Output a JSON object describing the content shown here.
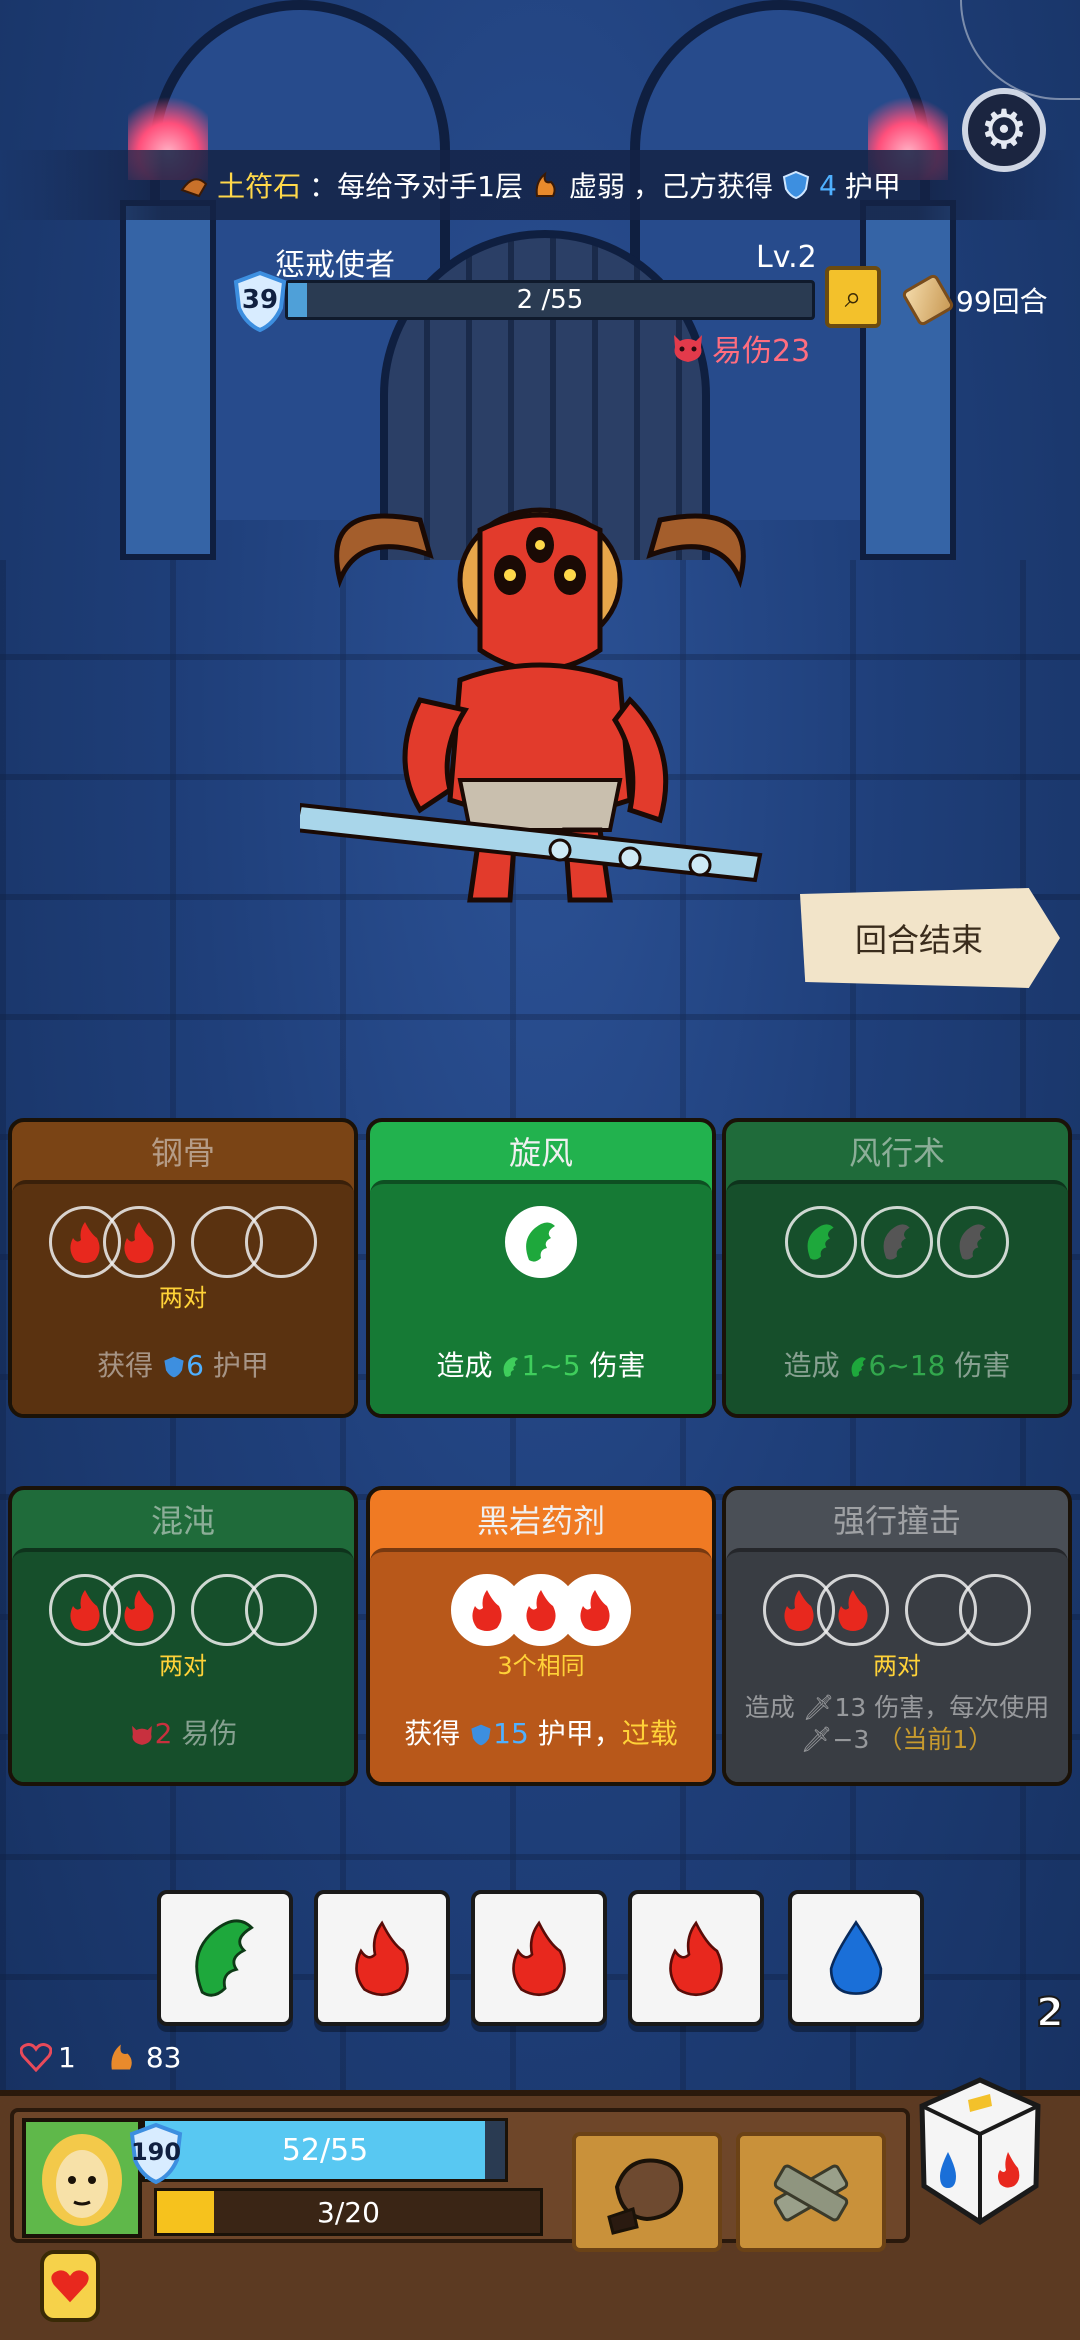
{
  "rune_banner": {
    "name": "土符石",
    "text_part1": "：每给予对手1层",
    "status_word": "虚弱",
    "text_part2": "，己方获得",
    "armor_value": "4",
    "armor_word": "护甲"
  },
  "enemy": {
    "name": "惩戒使者",
    "level": "Lv.2",
    "shield": "39",
    "hp_text": "2 /55",
    "hp_fraction": 0.036,
    "vulnerable": "易伤23"
  },
  "turns": "99回合",
  "end_turn_label": "回合结束",
  "cards": [
    {
      "title": "钢骨",
      "condition": "两对",
      "effect_prefix": "获得",
      "effect_value": "6",
      "effect_suffix": "护甲"
    },
    {
      "title": "旋风",
      "effect_prefix": "造成",
      "effect_value": "1~5",
      "effect_suffix": "伤害"
    },
    {
      "title": "风行术",
      "effect_prefix": "造成",
      "effect_value": "6~18",
      "effect_suffix": "伤害"
    },
    {
      "title": "混沌",
      "condition": "两对",
      "effect_value": "2",
      "effect_suffix": "易伤"
    },
    {
      "title": "黑岩药剂",
      "condition": "3个相同",
      "effect_prefix": "获得",
      "effect_value": "15",
      "effect_suffix": "护甲，",
      "effect_extra": "过载"
    },
    {
      "title": "强行撞击",
      "condition": "两对",
      "effect_line1": "造成",
      "effect_value": "13",
      "effect_line1_suffix": "伤害，每次使用",
      "effect_line2": "−3",
      "effect_note": "（当前1）"
    }
  ],
  "dice": [
    "leaf",
    "fire",
    "fire",
    "fire",
    "water"
  ],
  "player": {
    "hearts": "1",
    "flames": "83",
    "shield": "190",
    "hp_text": "52/55",
    "hp_fraction": 0.945,
    "energy_text": "3/20",
    "energy_fraction": 0.15
  },
  "dice_count": "2",
  "colors": {
    "fire": "#e8281e",
    "leaf": "#1ea83c",
    "water": "#1a6fd8"
  }
}
